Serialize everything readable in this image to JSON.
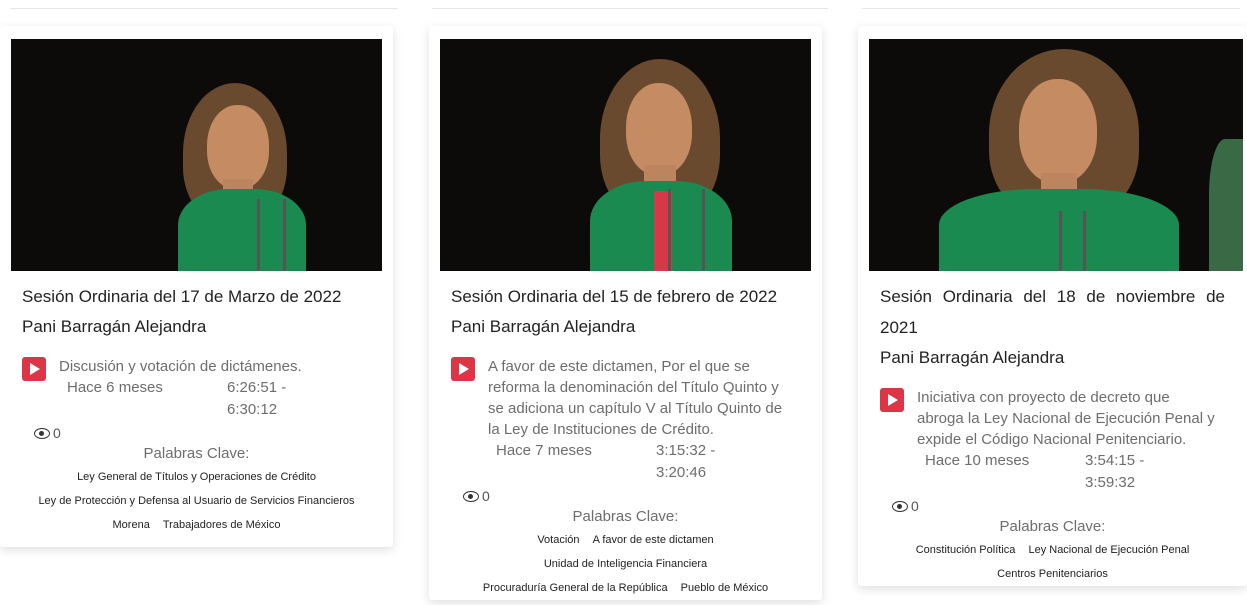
{
  "cards": [
    {
      "title": "Sesión Ordinaria del 17 de Marzo de 2022",
      "speaker": "Pani Barragán Alejandra",
      "description": "Discusión y votación de dictámenes.",
      "ago": "Hace 6 meses",
      "time_start": "6:26:51 -",
      "time_end": "6:30:12",
      "views": "0",
      "keywords_label": "Palabras Clave:",
      "keywords": [
        "Ley General de Títulos y Operaciones de Crédito",
        "Ley de Protección y Defensa al Usuario de Servicios Financieros",
        "Morena",
        "Trabajadores de México"
      ]
    },
    {
      "title": "Sesión Ordinaria del 15 de febrero de 2022",
      "speaker": "Pani Barragán Alejandra",
      "description": "A favor de este dictamen, Por el que se reforma la denominación del Título Quinto y se adiciona un capítulo V al Título Quinto de la Ley de Instituciones de Crédito.",
      "ago": "Hace 7 meses",
      "time_start": "3:15:32 -",
      "time_end": "3:20:46",
      "views": "0",
      "keywords_label": "Palabras Clave:",
      "keywords": [
        "Votación",
        "A favor de este dictamen",
        "Unidad de Inteligencia Financiera",
        "Procuraduría General de la República",
        "Pueblo de México"
      ]
    },
    {
      "title": "Sesión Ordinaria del 18 de noviembre de 2021",
      "speaker": "Pani Barragán Alejandra",
      "description": "Iniciativa con proyecto de decreto que abroga la Ley Nacional de Ejecución Penal y expide el Código Nacional Penitenciario.",
      "ago": "Hace 10 meses",
      "time_start": "3:54:15 -",
      "time_end": "3:59:32",
      "views": "0",
      "keywords_label": "Palabras Clave:",
      "keywords": [
        "Constitución Política",
        "Ley Nacional de Ejecución Penal",
        "Centros Penitenciarios"
      ]
    }
  ],
  "icons": {
    "play": "play-icon",
    "views": "eye-icon"
  },
  "colors": {
    "play_button": "#dc3545",
    "dress": "#1a8a50"
  }
}
